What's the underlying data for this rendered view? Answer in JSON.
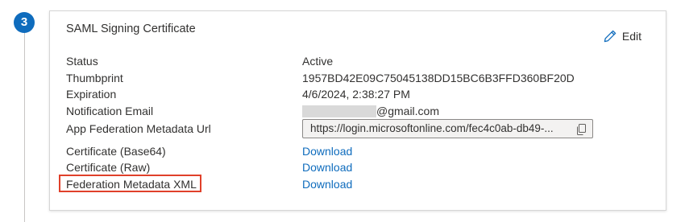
{
  "step": {
    "number": "3"
  },
  "card": {
    "title": "SAML Signing Certificate",
    "edit_label": "Edit"
  },
  "fields": {
    "status": {
      "label": "Status",
      "value": "Active"
    },
    "thumbprint": {
      "label": "Thumbprint",
      "value": "1957BD42E09C75045138DD15BC6B3FFD360BF20D"
    },
    "expiration": {
      "label": "Expiration",
      "value": "4/6/2024, 2:38:27 PM"
    },
    "notification_email": {
      "label": "Notification Email",
      "value": "@gmail.com"
    },
    "metadata_url": {
      "label": "App Federation Metadata Url",
      "value": "https://login.microsoftonline.com/fec4c0ab-db49-..."
    },
    "cert_base64": {
      "label": "Certificate (Base64)",
      "link": "Download"
    },
    "cert_raw": {
      "label": "Certificate (Raw)",
      "link": "Download"
    },
    "federation_xml": {
      "label": "Federation Metadata XML",
      "link": "Download"
    }
  },
  "colors": {
    "accent": "#0f6cbd",
    "highlight": "#e0402a"
  },
  "icons": {
    "edit": "pencil-icon",
    "copy": "copy-icon"
  }
}
